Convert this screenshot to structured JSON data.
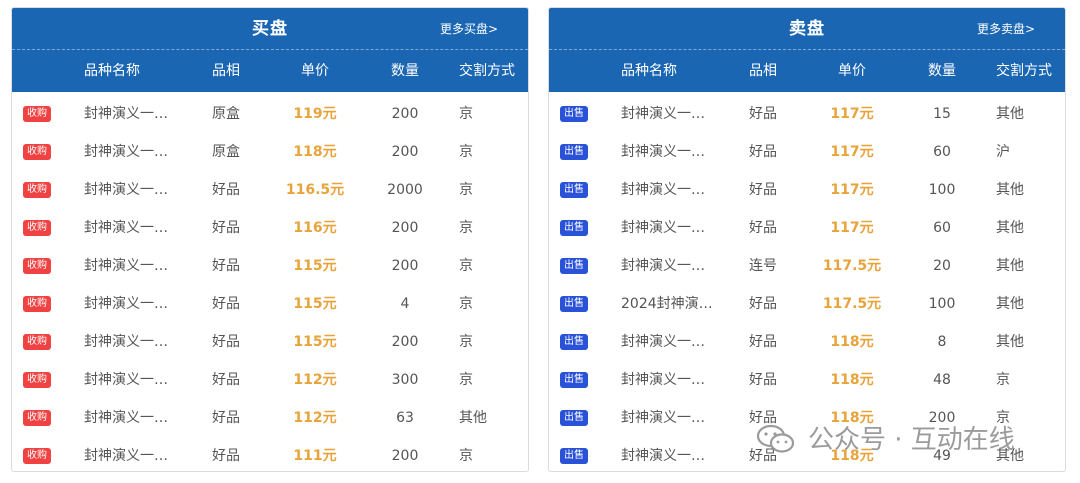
{
  "buy_panel": {
    "title": "买盘",
    "more_link": "更多买盘>",
    "columns": [
      "品种名称",
      "品相",
      "单价",
      "数量",
      "交割方式"
    ],
    "badge_label": "收购",
    "badge_color": "#f04242",
    "rows": [
      {
        "name": "封神演义一…",
        "condition": "原盒",
        "price": "119元",
        "qty": "200",
        "method": "京"
      },
      {
        "name": "封神演义一…",
        "condition": "原盒",
        "price": "118元",
        "qty": "200",
        "method": "京"
      },
      {
        "name": "封神演义一…",
        "condition": "好品",
        "price": "116.5元",
        "qty": "2000",
        "method": "京"
      },
      {
        "name": "封神演义一…",
        "condition": "好品",
        "price": "116元",
        "qty": "200",
        "method": "京"
      },
      {
        "name": "封神演义一…",
        "condition": "好品",
        "price": "115元",
        "qty": "200",
        "method": "京"
      },
      {
        "name": "封神演义一…",
        "condition": "好品",
        "price": "115元",
        "qty": "4",
        "method": "京"
      },
      {
        "name": "封神演义一…",
        "condition": "好品",
        "price": "115元",
        "qty": "200",
        "method": "京"
      },
      {
        "name": "封神演义一…",
        "condition": "好品",
        "price": "112元",
        "qty": "300",
        "method": "京"
      },
      {
        "name": "封神演义一…",
        "condition": "好品",
        "price": "112元",
        "qty": "63",
        "method": "其他"
      },
      {
        "name": "封神演义一…",
        "condition": "好品",
        "price": "111元",
        "qty": "200",
        "method": "京"
      }
    ]
  },
  "sell_panel": {
    "title": "卖盘",
    "more_link": "更多卖盘>",
    "columns": [
      "品种名称",
      "品相",
      "单价",
      "数量",
      "交割方式"
    ],
    "badge_label": "出售",
    "badge_color": "#2a52d8",
    "rows": [
      {
        "name": "封神演义一…",
        "condition": "好品",
        "price": "117元",
        "qty": "15",
        "method": "其他"
      },
      {
        "name": "封神演义一…",
        "condition": "好品",
        "price": "117元",
        "qty": "60",
        "method": "沪"
      },
      {
        "name": "封神演义一…",
        "condition": "好品",
        "price": "117元",
        "qty": "100",
        "method": "其他"
      },
      {
        "name": "封神演义一…",
        "condition": "好品",
        "price": "117元",
        "qty": "60",
        "method": "其他"
      },
      {
        "name": "封神演义一…",
        "condition": "连号",
        "price": "117.5元",
        "qty": "20",
        "method": "其他"
      },
      {
        "name": "2024封神演…",
        "condition": "好品",
        "price": "117.5元",
        "qty": "100",
        "method": "其他"
      },
      {
        "name": "封神演义一…",
        "condition": "好品",
        "price": "118元",
        "qty": "8",
        "method": "其他"
      },
      {
        "name": "封神演义一…",
        "condition": "好品",
        "price": "118元",
        "qty": "48",
        "method": "京"
      },
      {
        "name": "封神演义一…",
        "condition": "好品",
        "price": "118元",
        "qty": "200",
        "method": "京"
      },
      {
        "name": "封神演义一…",
        "condition": "好品",
        "price": "118元",
        "qty": "49",
        "method": "其他"
      }
    ]
  },
  "colors": {
    "header_blue": "#1a66b3",
    "price_orange": "#e8a33a"
  },
  "watermark": {
    "text": "公众号 · 互动在线",
    "icon": "wechat-icon"
  }
}
